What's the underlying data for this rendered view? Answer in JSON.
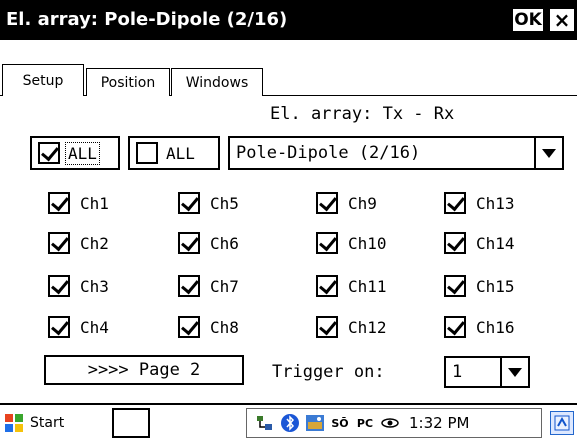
{
  "window": {
    "title": "El. array: Pole-Dipole (2/16)",
    "ok_label": "OK",
    "close_label": "×"
  },
  "tabs": [
    {
      "label": "Setup",
      "active": true
    },
    {
      "label": "Position",
      "active": false
    },
    {
      "label": "Windows",
      "active": false
    }
  ],
  "setup": {
    "array_label": "El. array: Tx - Rx",
    "all_checked_label": "ALL",
    "all_unchecked_label": "ALL",
    "array_select_value": "Pole-Dipole (2/16)",
    "channels": [
      {
        "label": "Ch1",
        "checked": true
      },
      {
        "label": "Ch2",
        "checked": true
      },
      {
        "label": "Ch3",
        "checked": true
      },
      {
        "label": "Ch4",
        "checked": true
      },
      {
        "label": "Ch5",
        "checked": true
      },
      {
        "label": "Ch6",
        "checked": true
      },
      {
        "label": "Ch7",
        "checked": true
      },
      {
        "label": "Ch8",
        "checked": true
      },
      {
        "label": "Ch9",
        "checked": true
      },
      {
        "label": "Ch10",
        "checked": true
      },
      {
        "label": "Ch11",
        "checked": true
      },
      {
        "label": "Ch12",
        "checked": true
      },
      {
        "label": "Ch13",
        "checked": true
      },
      {
        "label": "Ch14",
        "checked": true
      },
      {
        "label": "Ch15",
        "checked": true
      },
      {
        "label": "Ch16",
        "checked": true
      }
    ],
    "page_button_label": ">>>> Page 2",
    "trigger_label": "Trigger on:",
    "trigger_value": "1"
  },
  "taskbar": {
    "start_label": "Start",
    "tray_pc": "PC",
    "tray_so": "SŌ",
    "clock": "1:32 PM"
  },
  "colors": {
    "titlebar_bg": "#000000",
    "start_flag": [
      "#e8431f",
      "#3aa62d",
      "#1f6fe8",
      "#f5c20a"
    ]
  }
}
